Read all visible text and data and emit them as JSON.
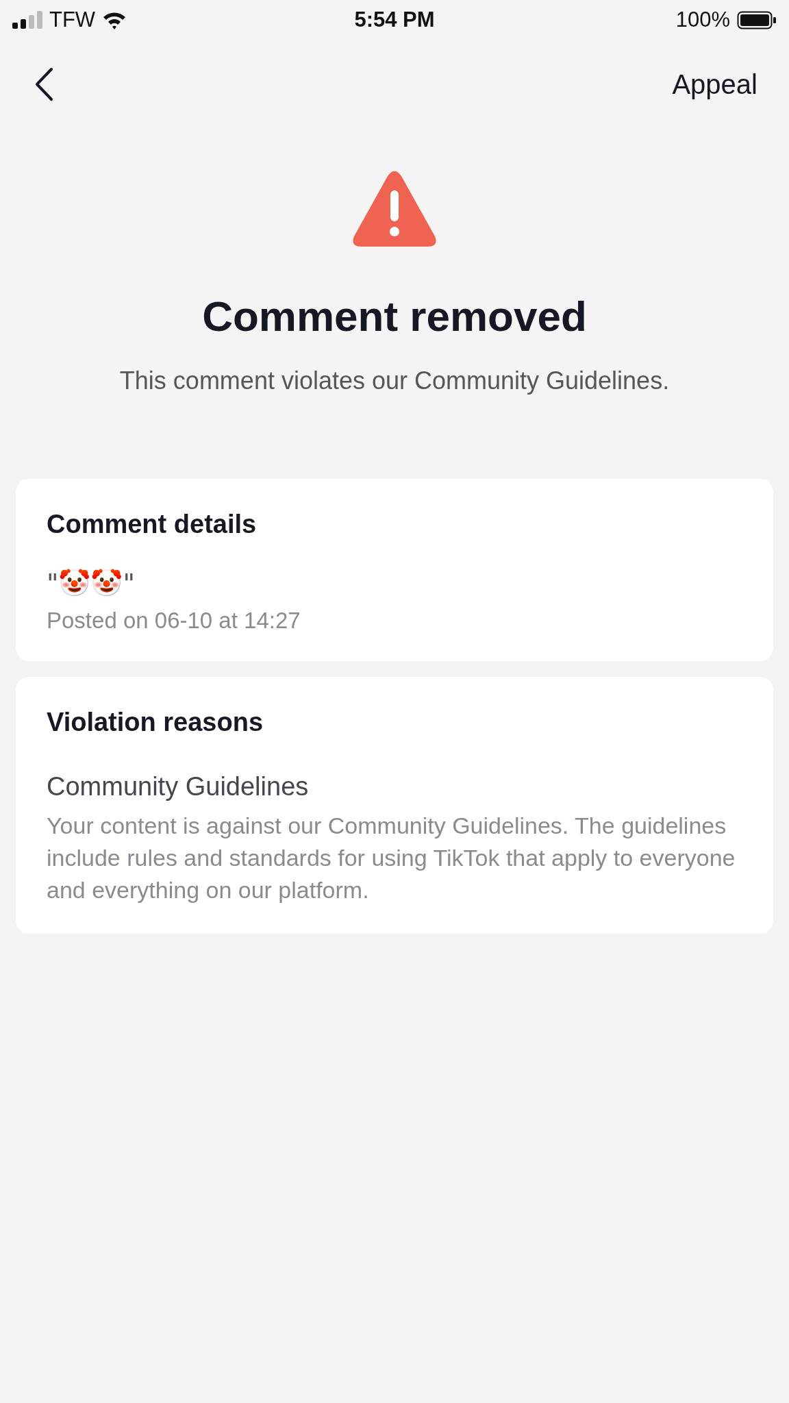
{
  "status_bar": {
    "carrier": "TFW",
    "time": "5:54 PM",
    "battery": "100%"
  },
  "nav": {
    "action": "Appeal"
  },
  "header": {
    "title": "Comment removed",
    "subtitle": "This comment violates our Community Guidelines."
  },
  "cards": [
    {
      "title": "Comment details",
      "comment": "\"🤡🤡\"",
      "meta": "Posted on 06-10 at 14:27"
    },
    {
      "title": "Violation reasons",
      "reason": "Community Guidelines",
      "description": "Your content is against our Community Guidelines. The guidelines include rules and standards for using TikTok that apply to everyone and everything on our platform."
    }
  ]
}
